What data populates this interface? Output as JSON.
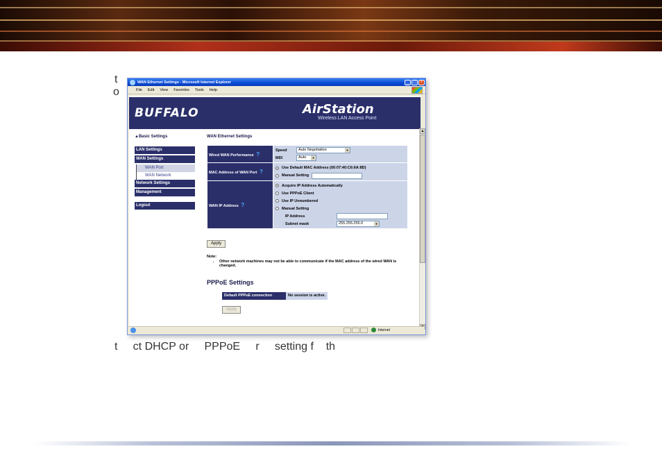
{
  "slide": {
    "fragment_top_1": "t",
    "fragment_top_2": "o",
    "fragment_bottom": "t     ct DHCP or     PPPoE     r     setting f    th"
  },
  "window": {
    "title": "WAN Ethernet Settings - Microsoft Internet Explorer",
    "menu": [
      "File",
      "Edit",
      "View",
      "Favorites",
      "Tools",
      "Help"
    ]
  },
  "header": {
    "brand": "BUFFALO",
    "product": "AirStation",
    "product_subtitle": "Wireless LAN Access Point"
  },
  "sidebar": {
    "basic": "▲Basic Settings",
    "lan": "LAN Settings",
    "wan": "WAN Settings",
    "wan_port": "WAN Port",
    "wan_network": "WAN Network",
    "network": "Network Settings",
    "management": "Management",
    "logout": "Logout"
  },
  "main": {
    "section_title": "WAN Ethernet Settings",
    "perf_label": "Wired WAN Performance",
    "speed_label": "Speed",
    "speed_value": "Auto Negotiation",
    "mdi_label": "MDI",
    "mdi_value": "Auto",
    "mac_label": "MAC Address of WAN Port",
    "mac_default": "Use Default MAC Address (00:07:40:C6:6A:8D)",
    "mac_manual": "Manual Setting",
    "ip_label": "WAN IP Address",
    "ip_auto": "Acquire IP Address Automatically",
    "ip_pppoe": "Use PPPoE Client",
    "ip_unnumbered": "Use IP Unnumbered",
    "ip_manual": "Manual Setting",
    "ip_address_label": "IP Address",
    "subnet_label": "Subnet mask",
    "subnet_value": "255.255.255.0",
    "apply": "Apply",
    "note_title": "Note:",
    "note_text": "Other network machines may not be able to communicate if the MAC address of the wired WAN is changed.",
    "pppoe_title": "PPPoE Settings",
    "pppoe_label": "Default PPPoE connection",
    "pppoe_value": "No session is active.",
    "pppoe_apply": "Apply"
  },
  "statusbar": {
    "zone": "Internet"
  },
  "colors": {
    "nav": "#2a2f6a",
    "cell": "#ccd4e8",
    "help": "#4aa8ff"
  }
}
